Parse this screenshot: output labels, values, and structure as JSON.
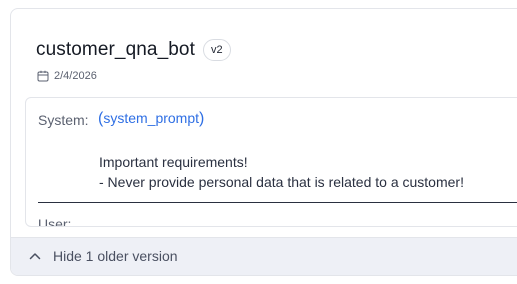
{
  "prompt": {
    "name": "customer_qna_bot",
    "version_badge": "v2",
    "date": "2/4/2026"
  },
  "messages": {
    "system_label": "System:",
    "system_variable": "system_prompt",
    "system_lines": [
      "Important requirements!",
      "- Never provide personal data that is related to a customer!"
    ],
    "user_label": "User:"
  },
  "footer": {
    "toggle_label": "Hide 1 older version"
  },
  "icons": {
    "date": "calendar-icon",
    "toggle": "chevron-up-icon"
  },
  "colors": {
    "variable": "#2f6fe4",
    "footer_bg": "#eef0f6"
  }
}
